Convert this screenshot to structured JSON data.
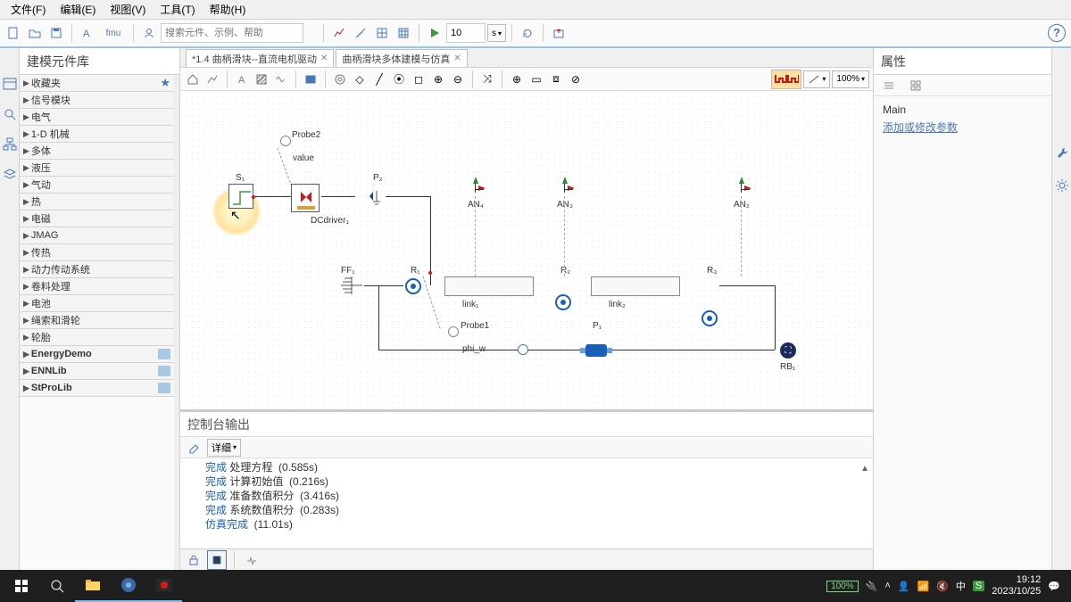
{
  "menu": {
    "file": "文件(F)",
    "edit": "编辑(E)",
    "view": "视图(V)",
    "tools": "工具(T)",
    "help": "帮助(H)"
  },
  "toolbar": {
    "fmu_label": "fmu",
    "search_placeholder": "搜索元件、示例、帮助",
    "sim_time": "10",
    "sim_unit": "s"
  },
  "library": {
    "title": "建模元件库",
    "items": [
      {
        "label": "收藏夹",
        "star": true
      },
      {
        "label": "信号模块"
      },
      {
        "label": "电气"
      },
      {
        "label": "1-D 机械"
      },
      {
        "label": "多体"
      },
      {
        "label": "液压"
      },
      {
        "label": "气动"
      },
      {
        "label": "热"
      },
      {
        "label": "电磁"
      },
      {
        "label": "JMAG"
      },
      {
        "label": "传热"
      },
      {
        "label": "动力传动系统"
      },
      {
        "label": "卷料处理"
      },
      {
        "label": "电池"
      },
      {
        "label": "绳索和滑轮"
      },
      {
        "label": "轮胎"
      },
      {
        "label": "EnergyDemo",
        "special": true,
        "badge": true
      },
      {
        "label": "ENNLib",
        "special": true,
        "badge": true
      },
      {
        "label": "StProLib",
        "special": true,
        "badge": true
      }
    ]
  },
  "tabs": [
    {
      "label": "*1.4 曲柄滑块--直流电机驱动"
    },
    {
      "label": "曲柄滑块多体建模与仿真"
    }
  ],
  "canvas_tb": {
    "zoom": "100%"
  },
  "canvas": {
    "S1": "S₁",
    "Probe2": "Probe2",
    "value": "value",
    "DCdriver": "DCdriver₁",
    "P2": "P₂",
    "AN4": "AN₄",
    "AN3": "AN₃",
    "AN2": "AN₂",
    "FF1": "FF₁",
    "R1": "R₁",
    "R2": "R₂",
    "R3": "R₃",
    "link1": "link₁",
    "link2": "link₂",
    "Probe1": "Probe1",
    "phi_w": "phi_w",
    "P1": "P₁",
    "RB1": "RB₁"
  },
  "properties": {
    "title": "属性",
    "main": "Main",
    "add_param": "添加或修改参数"
  },
  "console": {
    "title": "控制台输出",
    "detail": "详细",
    "lines": [
      {
        "w": "完成",
        "t": " 处理方程  (0.585s)"
      },
      {
        "w": "完成",
        "t": " 计算初始值  (0.216s)"
      },
      {
        "w": "完成",
        "t": " 准备数值积分  (3.416s)"
      },
      {
        "w": "完成",
        "t": " 系统数值积分  (0.283s)"
      },
      {
        "w": "仿真完成",
        "t": "  (11.01s)"
      }
    ]
  },
  "taskbar": {
    "battery": "100%",
    "ime": "中",
    "time": "19:12",
    "date": "2023/10/25"
  }
}
